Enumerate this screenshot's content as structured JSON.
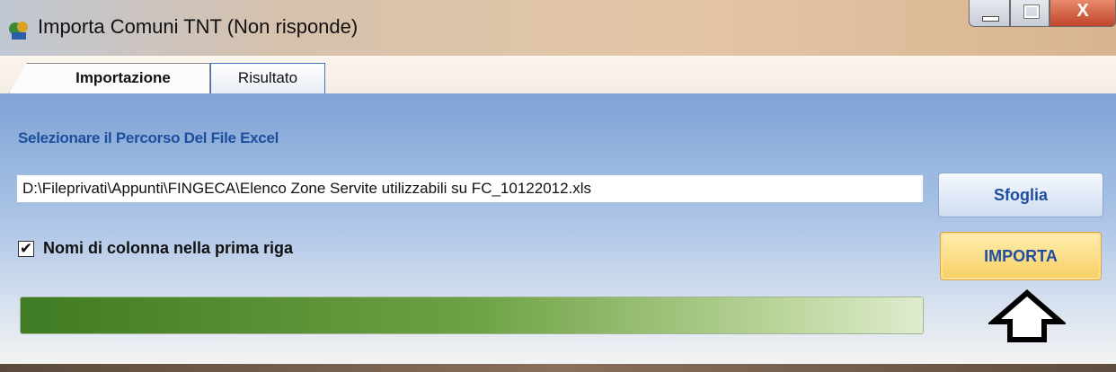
{
  "window": {
    "title": "Importa Comuni TNT (Non risponde)",
    "close_glyph": "X",
    "icon": "app-icon"
  },
  "tabs": [
    {
      "label": "Importazione",
      "selected": true
    },
    {
      "label": "Risultato",
      "selected": false
    }
  ],
  "form": {
    "section_label": "Selezionare il Percorso Del File Excel",
    "file_path": "D:\\Fileprivati\\Appunti\\FINGECA\\Elenco Zone Servite utilizzabili su FC_10122012.xls",
    "header_checkbox": {
      "label": "Nomi di colonna nella prima riga",
      "checked": true,
      "glyph": "✔"
    },
    "progress": 1.0
  },
  "buttons": {
    "browse": "Sfoglia",
    "import": "IMPORTA"
  },
  "annotation_icon": "up-arrow-icon",
  "colors": {
    "section_label": "#1d4f9d",
    "import_button": "#f8cf63",
    "progress": "#6da143"
  }
}
